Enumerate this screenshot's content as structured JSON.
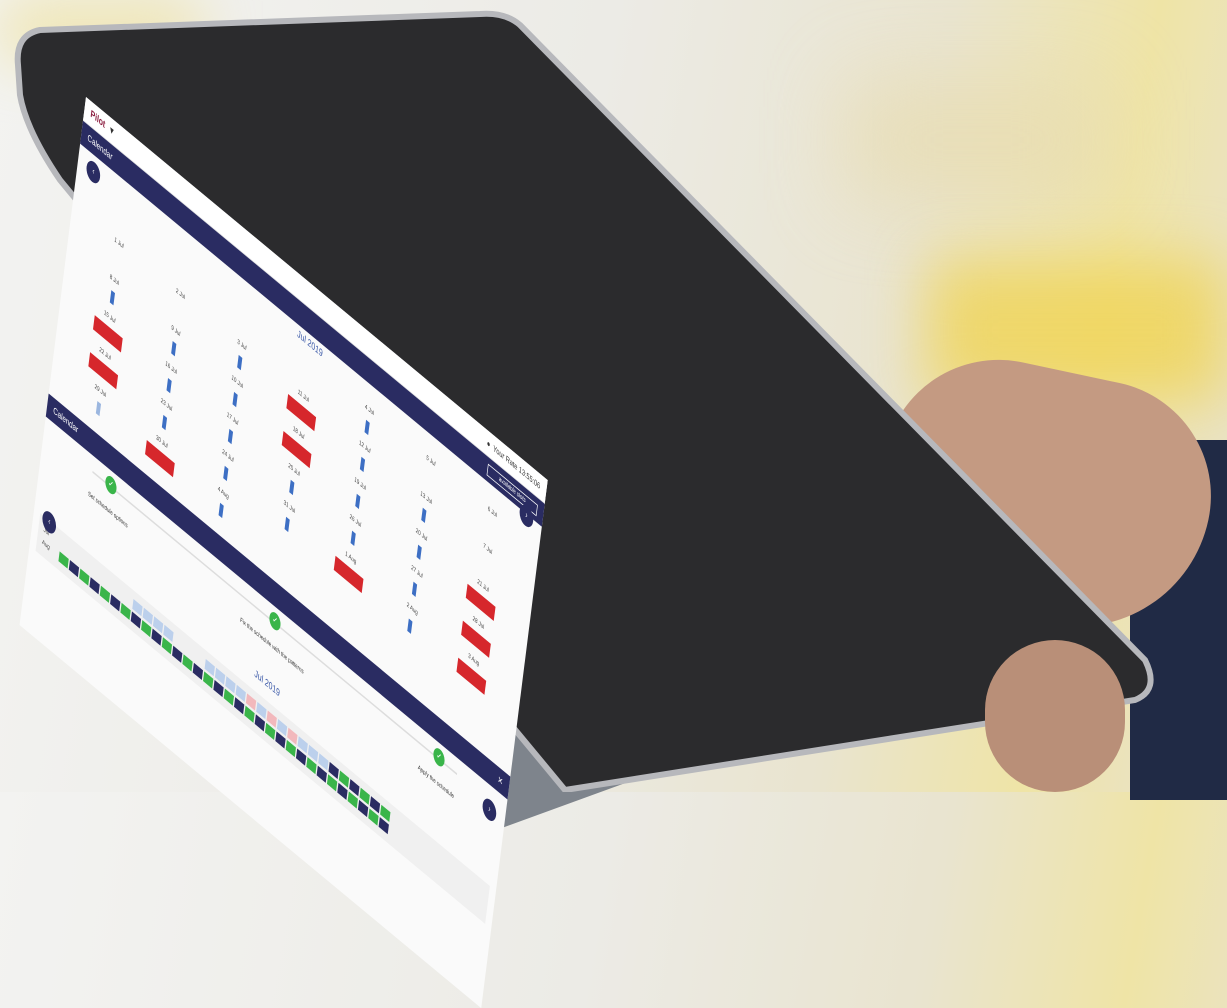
{
  "app": {
    "brand": "Pilot",
    "top_right": "Your Rate 13:55:06",
    "header_button": "available slots"
  },
  "calendar": {
    "title": "Calendar",
    "month": "Jul 2019",
    "prev_icon": "chevron-left-icon",
    "next_icon": "chevron-right-icon",
    "days": [
      {
        "label": "",
        "slot": "none"
      },
      {
        "label": "",
        "slot": "none"
      },
      {
        "label": "",
        "slot": "none"
      },
      {
        "label": "",
        "slot": "none"
      },
      {
        "label": "4 Jul",
        "slot": "blue"
      },
      {
        "label": "5 Jul",
        "slot": "none"
      },
      {
        "label": "6 Jul",
        "slot": "none"
      },
      {
        "label": "1 Jul",
        "slot": "none"
      },
      {
        "label": "2 Jul",
        "slot": "none"
      },
      {
        "label": "3 Jul",
        "slot": "blue"
      },
      {
        "label": "11 Jul",
        "slot": "red"
      },
      {
        "label": "12 Jul",
        "slot": "blue"
      },
      {
        "label": "13 Jul",
        "slot": "blue"
      },
      {
        "label": "7 Jul",
        "slot": "none"
      },
      {
        "label": "8 Jul",
        "slot": "blue"
      },
      {
        "label": "9 Jul",
        "slot": "blue"
      },
      {
        "label": "10 Jul",
        "slot": "blue"
      },
      {
        "label": "18 Jul",
        "slot": "red"
      },
      {
        "label": "19 Jul",
        "slot": "blue"
      },
      {
        "label": "20 Jul",
        "slot": "blue"
      },
      {
        "label": "21 Jul",
        "slot": "red"
      },
      {
        "label": "15 Jul",
        "slot": "red"
      },
      {
        "label": "16 Jul",
        "slot": "blue"
      },
      {
        "label": "17 Jul",
        "slot": "blue"
      },
      {
        "label": "25 Jul",
        "slot": "blue"
      },
      {
        "label": "26 Jul",
        "slot": "blue"
      },
      {
        "label": "27 Jul",
        "slot": "blue"
      },
      {
        "label": "28 Jul",
        "slot": "red"
      },
      {
        "label": "22 Jul",
        "slot": "red"
      },
      {
        "label": "23 Jul",
        "slot": "blue"
      },
      {
        "label": "24 Jul",
        "slot": "blue"
      },
      {
        "label": "31 Jul",
        "slot": "blue"
      },
      {
        "label": "1 Aug",
        "slot": "red"
      },
      {
        "label": "2 Aug",
        "slot": "blue"
      },
      {
        "label": "3 Aug",
        "slot": "red"
      },
      {
        "label": "29 Jul",
        "slot": "lblue"
      },
      {
        "label": "30 Jul",
        "slot": "red"
      },
      {
        "label": "4 Aug",
        "slot": "blue"
      }
    ]
  },
  "wizard": {
    "title": "Calendar",
    "close_icon": "close-icon",
    "month": "Jul 2019",
    "steps": [
      {
        "label": "Set schedule options",
        "icon": "check-icon"
      },
      {
        "label": "Fix the schedule with the patterns",
        "icon": "check-icon"
      },
      {
        "label": "Apply the schedule",
        "icon": "check-icon"
      }
    ],
    "rows": [
      {
        "label": "Jul",
        "cells": [
          "empty",
          "empty",
          "empty",
          "empty",
          "empty",
          "empty",
          "empty",
          "pale",
          "pale",
          "pale",
          "pale",
          "empty",
          "empty",
          "empty",
          "pale",
          "pale",
          "pale",
          "pale",
          "pink",
          "pale",
          "pink",
          "pale",
          "pink",
          "pale",
          "pale",
          "pale",
          "navy",
          "green",
          "navy",
          "green",
          "navy",
          "green"
        ]
      },
      {
        "label": "Aug",
        "cells": [
          "green",
          "navy",
          "green",
          "navy",
          "green",
          "navy",
          "green",
          "navy",
          "green",
          "navy",
          "green",
          "navy",
          "green",
          "navy",
          "green",
          "navy",
          "green",
          "navy",
          "green",
          "navy",
          "green",
          "navy",
          "green",
          "navy",
          "green",
          "navy",
          "green",
          "navy",
          "green",
          "navy",
          "green",
          "navy"
        ]
      }
    ]
  }
}
